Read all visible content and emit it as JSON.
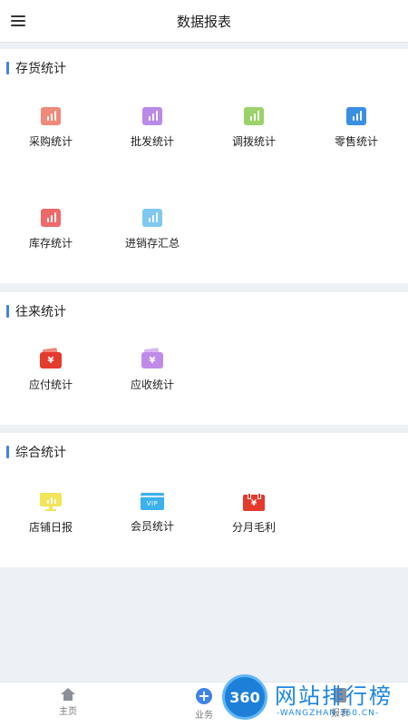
{
  "header": {
    "title": "数据报表",
    "menu_icon": "menu-icon"
  },
  "sections": [
    {
      "title": "存货统计",
      "items": [
        {
          "label": "采购统计",
          "icon": "chart-icon",
          "color": "#ef8a7a"
        },
        {
          "label": "批发统计",
          "icon": "chart-icon",
          "color": "#b98ae8"
        },
        {
          "label": "调拨统计",
          "icon": "chart-icon",
          "color": "#9bd26a"
        },
        {
          "label": "零售统计",
          "icon": "chart-icon",
          "color": "#3a8fe0"
        },
        {
          "label": "库存统计",
          "icon": "chart-icon",
          "color": "#ee6a6a"
        },
        {
          "label": "进销存汇总",
          "icon": "chart-icon",
          "color": "#7ec8f2"
        }
      ]
    },
    {
      "title": "往来统计",
      "items": [
        {
          "label": "应付统计",
          "icon": "wallet-icon",
          "color": "#e53a2e",
          "symbol": "¥"
        },
        {
          "label": "应收统计",
          "icon": "wallet-icon",
          "color": "#c08be8",
          "symbol": "¥"
        }
      ]
    },
    {
      "title": "综合统计",
      "items": [
        {
          "label": "店铺日报",
          "icon": "monitor-icon",
          "color": "#f2e55a"
        },
        {
          "label": "会员统计",
          "icon": "vip-card-icon",
          "color": "#3cb1ee",
          "symbol": "VIP"
        },
        {
          "label": "分月毛利",
          "icon": "calendar-icon",
          "color": "#e5392c",
          "symbol": "¥"
        }
      ]
    }
  ],
  "bottom_nav": [
    {
      "label": "主页",
      "icon": "home-icon"
    },
    {
      "label": "业务",
      "icon": "plus-icon"
    },
    {
      "label": "报表",
      "icon": "report-icon"
    }
  ],
  "watermark": {
    "badge": "360",
    "text": "网站排行榜",
    "sub": "-WANGZHAN.360.CN-"
  }
}
